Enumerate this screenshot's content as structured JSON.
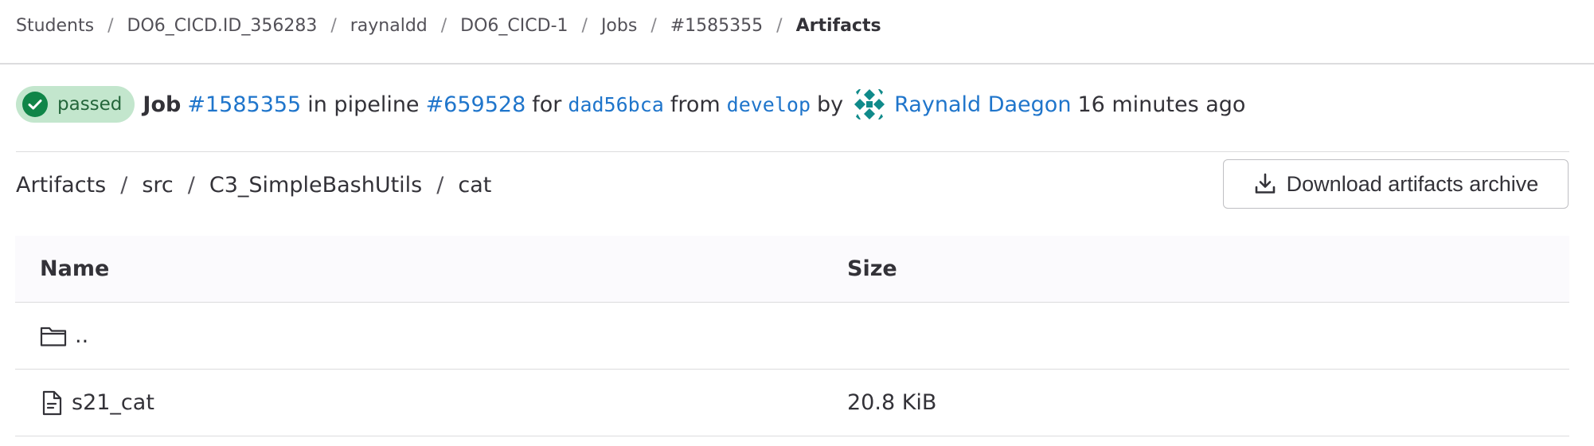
{
  "breadcrumb": {
    "items": [
      "Students",
      "DO6_CICD.ID_356283",
      "raynaldd",
      "DO6_CICD-1",
      "Jobs",
      "#1585355"
    ],
    "current": "Artifacts",
    "separator": "/"
  },
  "job": {
    "status": "passed",
    "job_label": "Job",
    "job_id": "#1585355",
    "in_pipeline_text": "in pipeline",
    "pipeline_id": "#659528",
    "for_text": "for",
    "commit_sha": "dad56bca",
    "from_text": "from",
    "branch": "develop",
    "by_text": "by",
    "user_name": "Raynald Daegon",
    "time_ago": "16 minutes ago"
  },
  "artifacts_path": {
    "segments": [
      "Artifacts",
      "src",
      "C3_SimpleBashUtils",
      "cat"
    ],
    "separator": "/"
  },
  "download_button": {
    "label": "Download artifacts archive",
    "icon": "download-icon"
  },
  "table": {
    "headers": {
      "name": "Name",
      "size": "Size"
    },
    "rows": [
      {
        "name": "..",
        "size": "",
        "icon": "folder-icon"
      },
      {
        "name": "s21_cat",
        "size": "20.8 KiB",
        "icon": "file-icon"
      }
    ]
  },
  "colors": {
    "link": "#1f75cb",
    "status_bg": "#c3e6cd",
    "status_text": "#24663b",
    "status_icon": "#108548",
    "avatar": "#0f8a8a",
    "border": "#dcdcde",
    "table_header_bg": "#fbfafd"
  }
}
